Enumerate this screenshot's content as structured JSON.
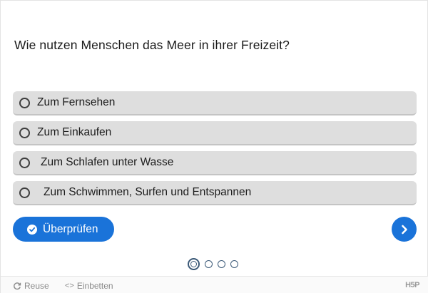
{
  "question": "Wie nutzen Menschen das Meer in ihrer Freizeit?",
  "answers": [
    {
      "label": "Zum Fernsehen"
    },
    {
      "label": "Zum Einkaufen"
    },
    {
      "label": "Zum Schlafen unter Wasse"
    },
    {
      "label": "Zum Schwimmen, Surfen und Entspannen"
    }
  ],
  "buttons": {
    "check_label": "Überprüfen"
  },
  "navigation": {
    "slides_total": 4,
    "current_slide": 1
  },
  "footer": {
    "reuse_label": "Reuse",
    "embed_label": "Einbetten",
    "brand": "H5P"
  },
  "colors": {
    "accent": "#1a73d9",
    "answer_bg": "#dedede",
    "dot_border": "#3c5a78"
  }
}
